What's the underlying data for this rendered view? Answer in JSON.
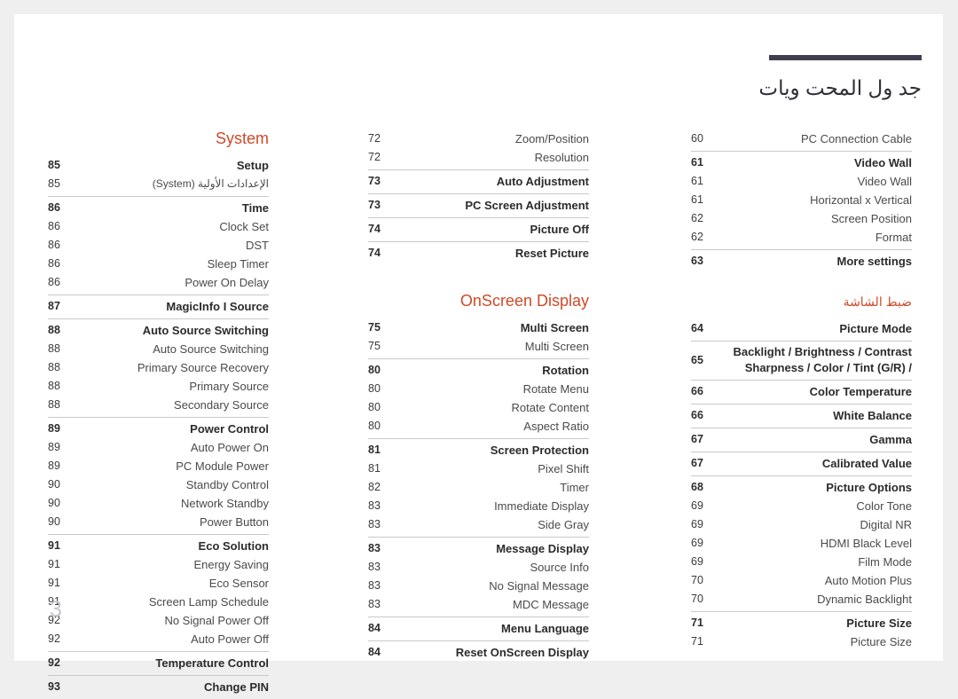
{
  "header": {
    "title": "جد ول المحت ويات",
    "rule_color": "#3f3f4f"
  },
  "page_number": "3",
  "accent_color": "#ce4a28",
  "columns": {
    "left": {
      "section_title": "System",
      "groups": [
        {
          "entries": [
            {
              "page": "85",
              "label": "Setup",
              "bold": true
            },
            {
              "page": "85",
              "label": "الإعدادات الأولية (System)",
              "bold": false,
              "rtl": true
            }
          ]
        },
        {
          "entries": [
            {
              "page": "86",
              "label": "Time",
              "bold": true
            },
            {
              "page": "86",
              "label": "Clock Set",
              "bold": false
            },
            {
              "page": "86",
              "label": "DST",
              "bold": false
            },
            {
              "page": "86",
              "label": "Sleep Timer",
              "bold": false
            },
            {
              "page": "86",
              "label": "Power On Delay",
              "bold": false
            }
          ]
        },
        {
          "entries": [
            {
              "page": "87",
              "label": "MagicInfo I Source",
              "bold": true
            }
          ]
        },
        {
          "entries": [
            {
              "page": "88",
              "label": "Auto Source Switching",
              "bold": true
            },
            {
              "page": "88",
              "label": "Auto Source Switching",
              "bold": false
            },
            {
              "page": "88",
              "label": "Primary Source Recovery",
              "bold": false
            },
            {
              "page": "88",
              "label": "Primary Source",
              "bold": false
            },
            {
              "page": "88",
              "label": "Secondary Source",
              "bold": false
            }
          ]
        },
        {
          "entries": [
            {
              "page": "89",
              "label": "Power Control",
              "bold": true
            },
            {
              "page": "89",
              "label": "Auto Power On",
              "bold": false
            },
            {
              "page": "89",
              "label": "PC Module Power",
              "bold": false
            },
            {
              "page": "90",
              "label": "Standby Control",
              "bold": false
            },
            {
              "page": "90",
              "label": "Network Standby",
              "bold": false
            },
            {
              "page": "90",
              "label": "Power Button",
              "bold": false
            }
          ]
        },
        {
          "entries": [
            {
              "page": "91",
              "label": "Eco Solution",
              "bold": true
            },
            {
              "page": "91",
              "label": "Energy Saving",
              "bold": false
            },
            {
              "page": "91",
              "label": "Eco Sensor",
              "bold": false
            },
            {
              "page": "91",
              "label": "Screen Lamp Schedule",
              "bold": false
            },
            {
              "page": "92",
              "label": "No Signal Power Off",
              "bold": false
            },
            {
              "page": "92",
              "label": "Auto Power Off",
              "bold": false
            }
          ]
        },
        {
          "entries": [
            {
              "page": "92",
              "label": "Temperature Control",
              "bold": true
            }
          ]
        },
        {
          "entries": [
            {
              "page": "93",
              "label": "Change PIN",
              "bold": true
            }
          ]
        }
      ]
    },
    "middle": {
      "section_title_top": "",
      "groups_top": [
        {
          "entries": [
            {
              "page": "72",
              "label": "Zoom/Position",
              "bold": false
            },
            {
              "page": "72",
              "label": "Resolution",
              "bold": false
            }
          ]
        },
        {
          "entries": [
            {
              "page": "73",
              "label": "Auto Adjustment",
              "bold": true
            }
          ]
        },
        {
          "entries": [
            {
              "page": "73",
              "label": "PC Screen Adjustment",
              "bold": true
            }
          ]
        },
        {
          "entries": [
            {
              "page": "74",
              "label": "Picture Off",
              "bold": true
            }
          ]
        },
        {
          "entries": [
            {
              "page": "74",
              "label": "Reset Picture",
              "bold": true
            }
          ]
        }
      ],
      "section_title": "OnScreen Display",
      "groups": [
        {
          "entries": [
            {
              "page": "75",
              "label": "Multi Screen",
              "bold": true
            },
            {
              "page": "75",
              "label": "Multi Screen",
              "bold": false
            }
          ]
        },
        {
          "entries": [
            {
              "page": "80",
              "label": "Rotation",
              "bold": true
            },
            {
              "page": "80",
              "label": "Rotate Menu",
              "bold": false
            },
            {
              "page": "80",
              "label": "Rotate Content",
              "bold": false
            },
            {
              "page": "80",
              "label": "Aspect Ratio",
              "bold": false
            }
          ]
        },
        {
          "entries": [
            {
              "page": "81",
              "label": "Screen Protection",
              "bold": true
            },
            {
              "page": "81",
              "label": "Pixel Shift",
              "bold": false
            },
            {
              "page": "82",
              "label": "Timer",
              "bold": false
            },
            {
              "page": "83",
              "label": "Immediate Display",
              "bold": false
            },
            {
              "page": "83",
              "label": "Side Gray",
              "bold": false
            }
          ]
        },
        {
          "entries": [
            {
              "page": "83",
              "label": "Message Display",
              "bold": true
            },
            {
              "page": "83",
              "label": "Source Info",
              "bold": false
            },
            {
              "page": "83",
              "label": "No Signal Message",
              "bold": false
            },
            {
              "page": "83",
              "label": "MDC Message",
              "bold": false
            }
          ]
        },
        {
          "entries": [
            {
              "page": "84",
              "label": "Menu Language",
              "bold": true
            }
          ]
        },
        {
          "entries": [
            {
              "page": "84",
              "label": "Reset OnScreen Display",
              "bold": true
            }
          ]
        }
      ]
    },
    "right": {
      "groups_top": [
        {
          "entries": [
            {
              "page": "60",
              "label": "PC Connection Cable",
              "bold": false
            }
          ]
        },
        {
          "entries": [
            {
              "page": "61",
              "label": "Video Wall",
              "bold": true
            },
            {
              "page": "61",
              "label": "Video Wall",
              "bold": false
            },
            {
              "page": "61",
              "label": "Horizontal x Vertical",
              "bold": false
            },
            {
              "page": "62",
              "label": "Screen Position",
              "bold": false
            },
            {
              "page": "62",
              "label": "Format",
              "bold": false
            }
          ]
        },
        {
          "entries": [
            {
              "page": "63",
              "label": "More settings",
              "bold": true
            }
          ]
        }
      ],
      "section_title": "ضبط الشاشة",
      "groups": [
        {
          "entries": [
            {
              "page": "64",
              "label": "Picture Mode",
              "bold": true
            }
          ]
        },
        {
          "entries": [
            {
              "page": "65",
              "label": "Backlight / Brightness / Contrast\nSharpness / Color / Tint (G/R) /",
              "bold": true,
              "two_line": true
            }
          ]
        },
        {
          "entries": [
            {
              "page": "66",
              "label": "Color Temperature",
              "bold": true
            }
          ]
        },
        {
          "entries": [
            {
              "page": "66",
              "label": "White Balance",
              "bold": true
            }
          ]
        },
        {
          "entries": [
            {
              "page": "67",
              "label": "Gamma",
              "bold": true
            }
          ]
        },
        {
          "entries": [
            {
              "page": "67",
              "label": "Calibrated Value",
              "bold": true
            }
          ]
        },
        {
          "entries": [
            {
              "page": "68",
              "label": "Picture Options",
              "bold": true
            },
            {
              "page": "69",
              "label": "Color Tone",
              "bold": false
            },
            {
              "page": "69",
              "label": "Digital NR",
              "bold": false
            },
            {
              "page": "69",
              "label": "HDMI Black Level",
              "bold": false
            },
            {
              "page": "69",
              "label": "Film Mode",
              "bold": false
            },
            {
              "page": "70",
              "label": "Auto Motion Plus",
              "bold": false
            },
            {
              "page": "70",
              "label": "Dynamic Backlight",
              "bold": false
            }
          ]
        },
        {
          "entries": [
            {
              "page": "71",
              "label": "Picture Size",
              "bold": true
            },
            {
              "page": "71",
              "label": "Picture Size",
              "bold": false
            }
          ]
        }
      ]
    }
  }
}
